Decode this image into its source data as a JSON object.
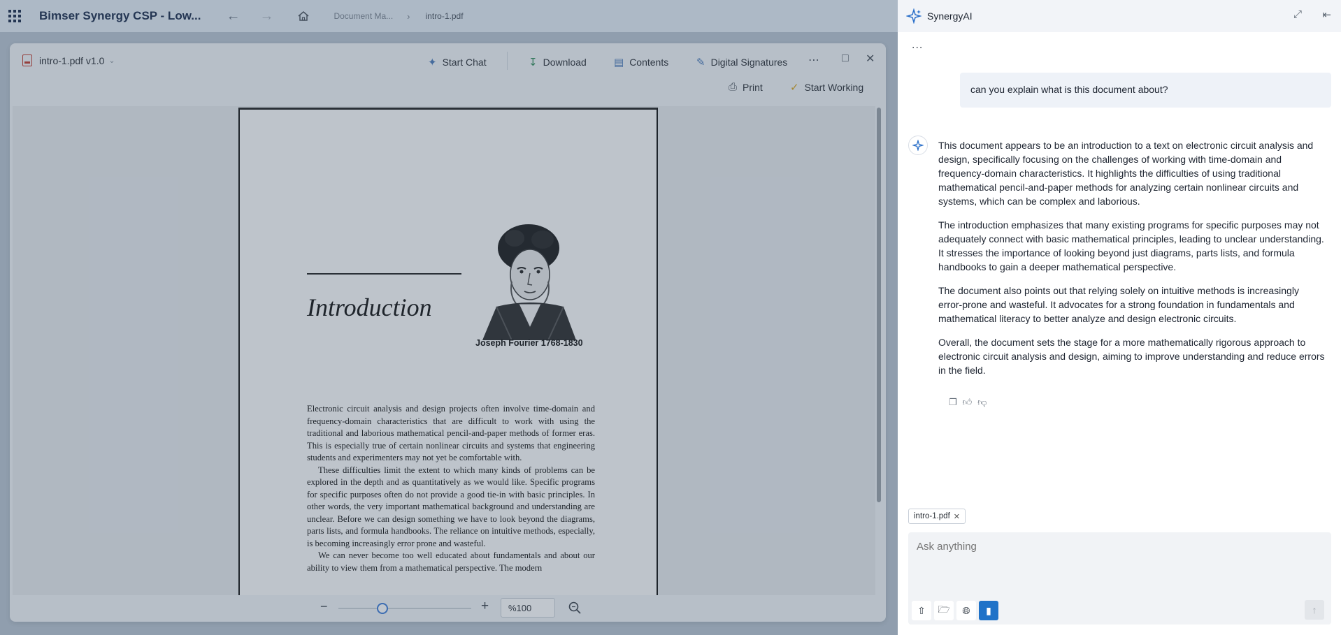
{
  "appbar": {
    "title": "Bimser Synergy CSP - Low...",
    "breadcrumb": [
      "Document Ma...",
      "intro-1.pdf"
    ]
  },
  "viewer": {
    "file_label": "intro-1.pdf v1.0",
    "toolbar": {
      "start_chat": "Start Chat",
      "download": "Download",
      "contents": "Contents",
      "digital_signatures": "Digital Signatures",
      "print": "Print",
      "start_working": "Start Working"
    },
    "page": {
      "heading": "Introduction",
      "caption": "Joseph Fourier 1768-1830",
      "paragraphs": [
        "Electronic circuit analysis and design projects often involve time-domain and frequency-domain characteristics that are difficult to work with using the traditional and laborious mathematical pencil-and-paper methods of former eras. This is especially true of certain nonlinear circuits and systems that engineering students and experimenters may not yet be comfortable with.",
        "These difficulties limit the extent to which many kinds of problems can be explored in the depth and as quantitatively as we would like. Specific programs for specific purposes often do not provide a good tie-in with basic principles. In other words, the very important mathematical background and understanding are unclear. Before we can design something we have to look beyond the diagrams, parts lists, and formula handbooks. The reliance on intuitive methods, especially, is becoming increasingly error prone and wasteful.",
        "We can never become too well educated about fundamentals and about our ability to view them from a mathematical perspective. The modern"
      ]
    },
    "zoom": {
      "value": "%100",
      "level_fraction": 0.33
    }
  },
  "ai_panel": {
    "title": "SynergyAI",
    "more": "...",
    "user_message": "can you explain what is this document about?",
    "bot_paragraphs": [
      "This document appears to be an introduction to a text on electronic circuit analysis and design, specifically focusing on the challenges of working with time-domain and frequency-domain characteristics. It highlights the difficulties of using traditional mathematical pencil-and-paper methods for analyzing certain nonlinear circuits and systems, which can be complex and laborious.",
      "The introduction emphasizes that many existing programs for specific purposes may not adequately connect with basic mathematical principles, leading to unclear understanding. It stresses the importance of looking beyond just diagrams, parts lists, and formula handbooks to gain a deeper mathematical perspective.",
      "The document also points out that relying solely on intuitive methods is increasingly error-prone and wasteful. It advocates for a strong foundation in fundamentals and mathematical literacy to better analyze and design electronic circuits.",
      "Overall, the document sets the stage for a more mathematically rigorous approach to electronic circuit analysis and design, aiming to improve understanding and reduce errors in the field."
    ],
    "attached_file": "intro-1.pdf",
    "composer_placeholder": "Ask anything"
  },
  "colors": {
    "accent": "#1f72c8",
    "brand_dark": "#1a2c4c",
    "pdf_red": "#c0392b"
  },
  "icons": [
    "apps-grid-icon",
    "back-arrow-icon",
    "forward-arrow-icon",
    "home-icon",
    "pdf-file-icon",
    "sparkle-icon",
    "download-icon",
    "contents-icon",
    "signature-icon",
    "more-icon",
    "maximize-icon",
    "close-icon",
    "print-icon",
    "start-working-icon",
    "zoom-out-icon",
    "zoom-in-icon",
    "search-icon",
    "expand-icon",
    "pin-icon",
    "copy-icon",
    "thumbs-up-icon",
    "thumbs-down-icon",
    "upload-icon",
    "folder-icon",
    "globe-icon",
    "document-icon",
    "send-icon"
  ]
}
